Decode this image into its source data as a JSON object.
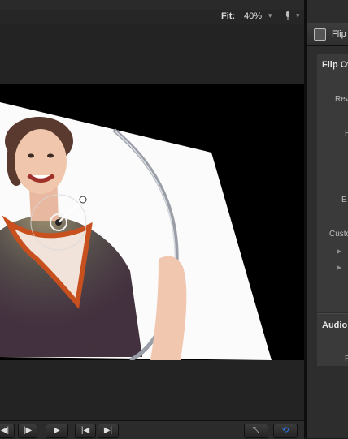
{
  "viewer": {
    "fit_label": "Fit:",
    "fit_value": "40%"
  },
  "inspector": {
    "header_title": "Flip",
    "panel1_title": "Flip Ov",
    "params": [
      "Rev",
      "H",
      "E",
      "Custo"
    ],
    "audio_title": "Audio",
    "audio_param": "F"
  },
  "transport": {
    "buttons": [
      "◀︎|",
      "|▶︎",
      "▶",
      "|◀",
      "▶|",
      "⤡",
      "⟲"
    ]
  },
  "colors": {
    "accent_loop": "#2f7bff",
    "bg": "#1c1c1c"
  }
}
